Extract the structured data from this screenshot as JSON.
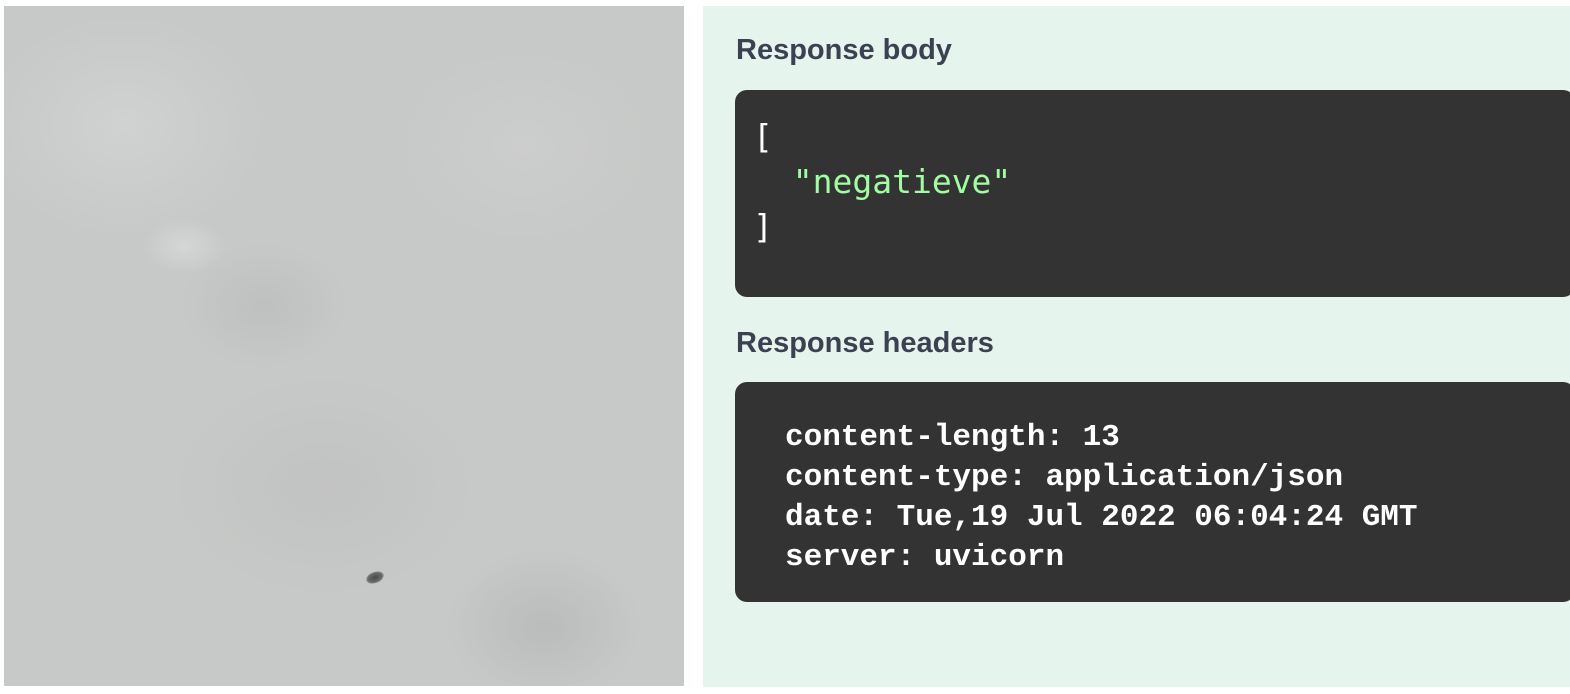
{
  "response_body": {
    "heading": "Response body",
    "open_bracket": "[",
    "value": "\"negatieve\"",
    "close_bracket": "]"
  },
  "response_headers": {
    "heading": "Response headers",
    "lines": [
      "content-length: 13",
      "content-type: application/json",
      "date: Tue,19 Jul 2022 06:04:24 GMT",
      "server: uvicorn"
    ]
  },
  "colors": {
    "panel_bg": "#e6f4ee",
    "code_bg": "#333333",
    "string_green": "#a2fca2",
    "heading_text": "#3b4151"
  }
}
